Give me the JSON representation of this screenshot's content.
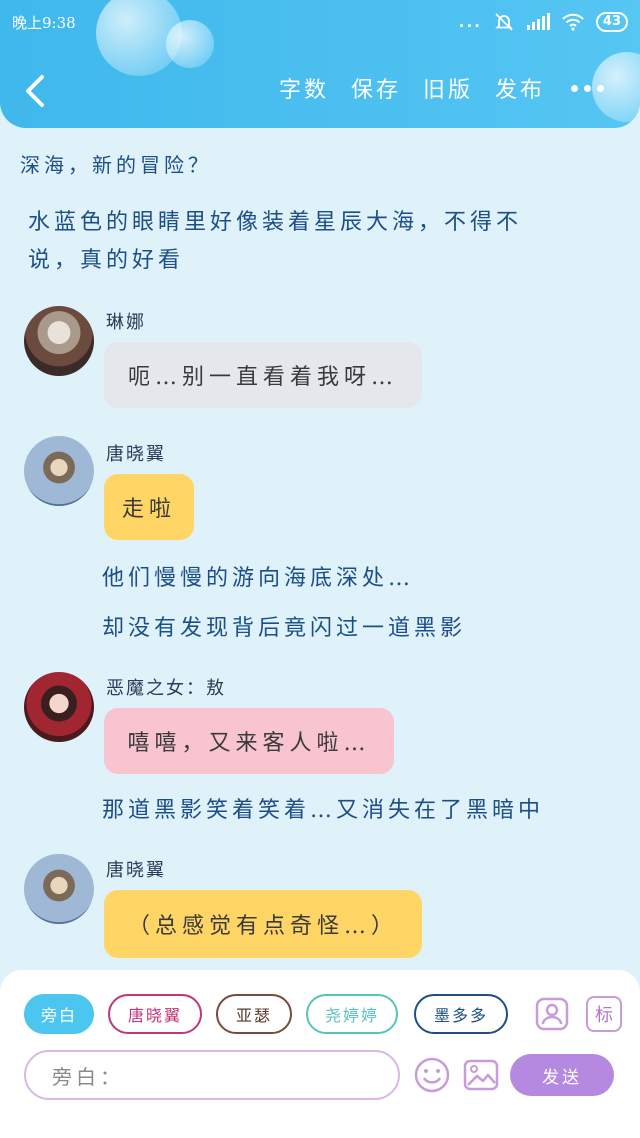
{
  "status_bar": {
    "time": "晚上9:38",
    "signal_dots": "...",
    "battery": "43"
  },
  "nav": {
    "back_icon": "chevron-left-icon",
    "actions": [
      "字数",
      "保存",
      "旧版",
      "发布"
    ],
    "more_icon": "more-horizontal-icon"
  },
  "chat": {
    "narration_1": "深海，新的冒险？",
    "narration_2_line1": "水蓝色的眼睛里好像装着星辰大海，不得不",
    "narration_2_line2": "说，真的好看",
    "msg1": {
      "name": "琳娜",
      "text": "呃…别一直看着我呀…",
      "color": "#e4e7ec"
    },
    "msg2": {
      "name": "唐晓翼",
      "text": "走啦",
      "color": "#ffd666"
    },
    "narration_3": "他们慢慢的游向海底深处…",
    "narration_4": "却没有发现背后竟闪过一道黑影",
    "msg3": {
      "name": "恶魔之女：敖",
      "text": "嘻嘻，又来客人啦…",
      "color": "#f7c4cf"
    },
    "narration_5": "那道黑影笑着笑着…又消失在了黑暗中",
    "msg4": {
      "name": "唐晓翼",
      "text": "（总感觉有点奇怪…）",
      "color": "#ffd666"
    }
  },
  "composer": {
    "chips": [
      {
        "label": "旁白",
        "active": true,
        "color": "#4cc6ef"
      },
      {
        "label": "唐晓翼",
        "active": false,
        "color": "#c2357a"
      },
      {
        "label": "亚瑟",
        "active": false,
        "color": "#7a4a3a"
      },
      {
        "label": "尧婷婷",
        "active": false,
        "color": "#56c3bd"
      },
      {
        "label": "墨多多",
        "active": false,
        "color": "#1d4f86"
      }
    ],
    "character_icon": "person-card-icon",
    "tag_label": "标",
    "input_placeholder": "旁白：",
    "emoji_icon": "smiley-icon",
    "image_icon": "image-icon",
    "send_label": "发送"
  }
}
